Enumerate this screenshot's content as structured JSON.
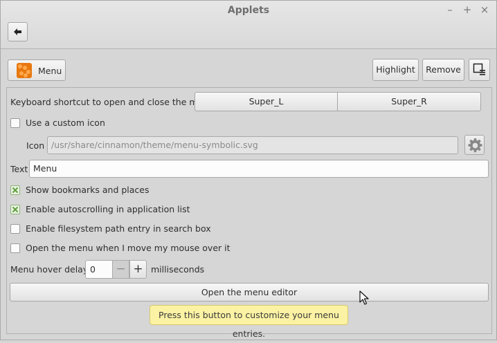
{
  "window": {
    "title": "Applets",
    "controls": {
      "minimize": "–",
      "maximize": "+",
      "close": "×"
    }
  },
  "header": {
    "applet_name": "Menu",
    "highlight_label": "Highlight",
    "remove_label": "Remove"
  },
  "settings": {
    "shortcut_label": "Keyboard shortcut to open and close the menu",
    "shortcut_values": [
      "Super_L",
      "Super_R"
    ],
    "custom_icon": {
      "label": "Use a custom icon",
      "checked": false
    },
    "icon_label": "Icon",
    "icon_path": "/usr/share/cinnamon/theme/menu-symbolic.svg",
    "text_label": "Text",
    "text_value": "Menu",
    "show_bookmarks": {
      "label": "Show bookmarks and places",
      "checked": true
    },
    "autoscroll": {
      "label": "Enable autoscrolling in application list",
      "checked": true
    },
    "filesystem_path": {
      "label": "Enable filesystem path entry in search box",
      "checked": false
    },
    "hover_open": {
      "label": "Open the menu when I move my mouse over it",
      "checked": false
    },
    "hover_delay_label": "Menu hover delay:",
    "hover_delay_value": "0",
    "hover_delay_units": "milliseconds",
    "spin_minus": "−",
    "spin_plus": "+",
    "editor_button": "Open the menu editor",
    "tooltip": "Press this button to customize your menu entries."
  }
}
